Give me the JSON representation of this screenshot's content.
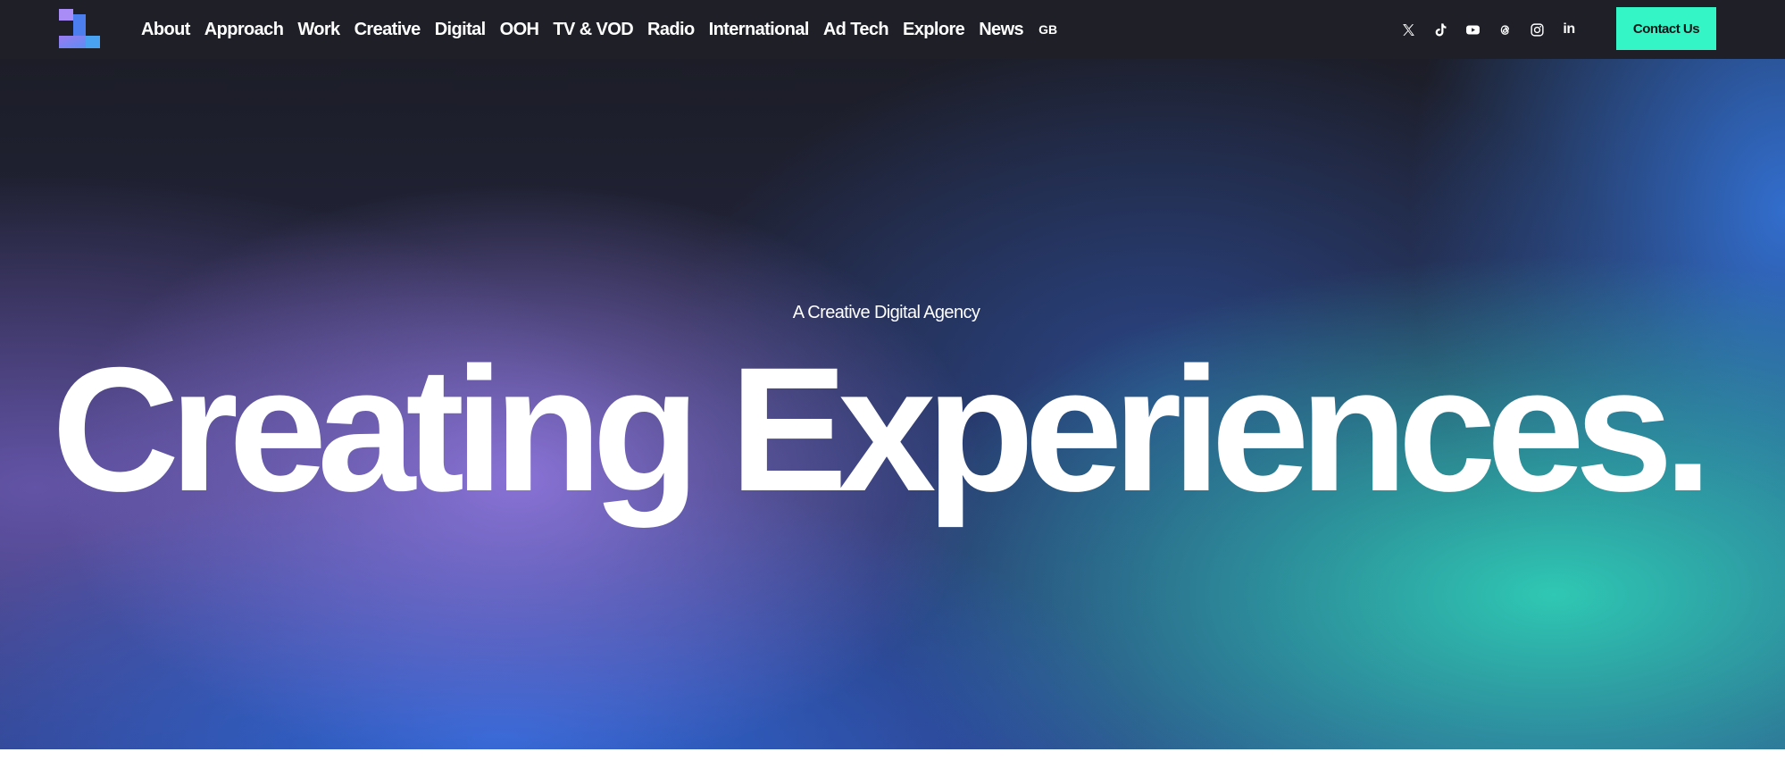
{
  "header": {
    "logo_icon": "agency-logo-icon",
    "nav": [
      "About",
      "Approach",
      "Work",
      "Creative",
      "Digital",
      "OOH",
      "TV & VOD",
      "Radio",
      "International",
      "Ad Tech",
      "Explore",
      "News"
    ],
    "region": "GB",
    "socials": [
      {
        "icon": "x-twitter-icon"
      },
      {
        "icon": "tiktok-icon"
      },
      {
        "icon": "youtube-icon"
      },
      {
        "icon": "threads-icon"
      },
      {
        "icon": "instagram-icon"
      },
      {
        "icon": "linkedin-icon",
        "text": "in"
      }
    ],
    "contact_label": "Contact Us",
    "colors": {
      "bar": "#1e1f27",
      "cta": "#34f5c5"
    }
  },
  "hero": {
    "subtitle": "A Creative Digital Agency",
    "title": "Creating Experiences.",
    "colors": {
      "purple": "#8e76dc",
      "blue": "#3068d6",
      "teal": "#2fc8b4",
      "dark": "#1c1d27"
    }
  }
}
